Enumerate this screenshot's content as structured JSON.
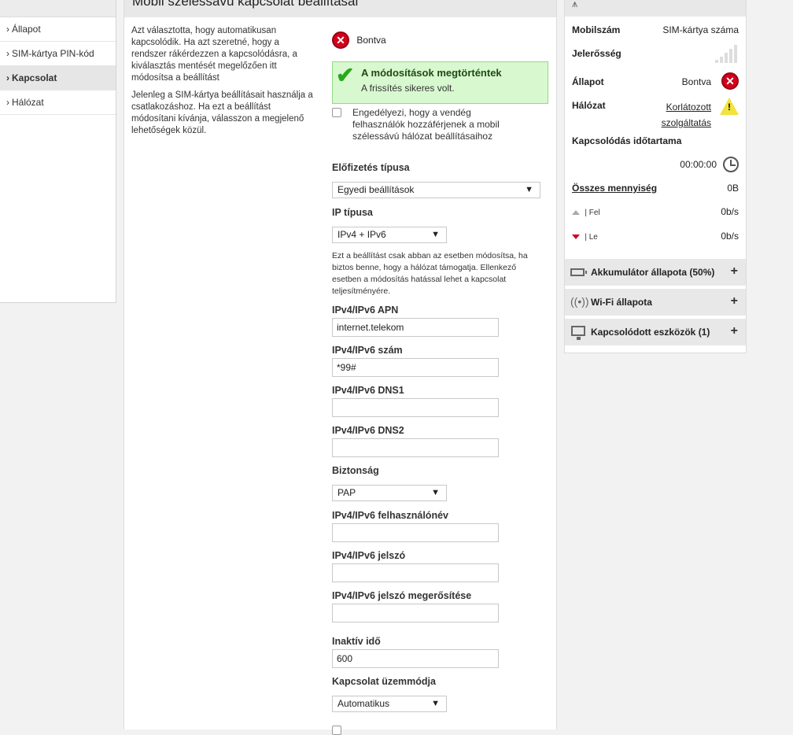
{
  "nav": {
    "items": [
      {
        "label": "Állapot",
        "active": false
      },
      {
        "label": "SIM-kártya PIN-kód",
        "active": false
      },
      {
        "label": "Kapcsolat",
        "active": true
      },
      {
        "label": "Hálózat",
        "active": false
      }
    ]
  },
  "main": {
    "title": "Mobil szélessávú kapcsolat beállításai",
    "description": [
      "Azt választotta, hogy automatikusan kapcsolódik. Ha azt szeretné, hogy a rendszer rákérdezzen a kapcsolódásra, a kiválasztás mentését megelőzően itt módosítsa a beállítást",
      "Jelenleg a SIM-kártya beállításait használja a csatlakozáshoz. Ha ezt a beállítást módosítani kívánja, válasszon a megjelenő lehetőségek közül."
    ],
    "status": "Bontva",
    "success_title": "A módosítások megtörténtek",
    "success_message": "A frissítés sikeres volt.",
    "guest_checkbox_label": "Engedélyezi, hogy a vendég felhasználók hozzáférjenek a mobil szélessávú hálózat beállításaihoz",
    "subscription_type_label": "Előfizetés típusa",
    "subscription_type_value": "Egyedi beállítások",
    "ip_type_label": "IP típusa",
    "ip_type_value": "IPv4 + IPv6",
    "ip_note": "Ezt a beállítást csak abban az esetben módosítsa, ha biztos benne, hogy a hálózat támogatja. Ellenkező esetben a módosítás hatással lehet a kapcsolat teljesítményére.",
    "apn_label": "IPv4/IPv6 APN",
    "apn_value": "internet.telekom",
    "number_label": "IPv4/IPv6 szám",
    "number_value": "*99#",
    "dns1_label": "IPv4/IPv6 DNS1",
    "dns1_value": "",
    "dns2_label": "IPv4/IPv6 DNS2",
    "dns2_value": "",
    "security_label": "Biztonság",
    "security_value": "PAP",
    "username_label": "IPv4/IPv6 felhasználónév",
    "username_value": "",
    "password_label": "IPv4/IPv6 jelszó",
    "password_value": "",
    "password_confirm_label": "IPv4/IPv6 jelszó megerősítése",
    "password_confirm_value": "",
    "idle_label": "Inaktív idő",
    "idle_value": "600",
    "mode_label": "Kapcsolat üzemmódja",
    "mode_value": "Automatikus"
  },
  "right": {
    "mobile_number_label": "Mobilszám",
    "mobile_number_value": "SIM-kártya száma",
    "signal_label": "Jelerősség",
    "state_label": "Állapot",
    "state_value": "Bontva",
    "network_label": "Hálózat",
    "network_value_line1": "Korlátozott",
    "network_value_line2": "szolgáltatás",
    "duration_label": "Kapcsolódás időtartama",
    "duration_value": "00:00:00",
    "total_label": "Összes mennyiség",
    "total_value": "0B",
    "up_label": "| Fel",
    "up_value": "0b/s",
    "down_label": "| Le",
    "down_value": "0b/s",
    "accordions": [
      {
        "title": "Akkumulátor állapota (50%)",
        "icon": "battery-icon"
      },
      {
        "title": "Wi-Fi állapota",
        "icon": "wifi-icon"
      },
      {
        "title": "Kapcsolódott eszközök (1)",
        "icon": "monitor-icon"
      }
    ]
  },
  "colors": {
    "error_red": "#d0021b",
    "success_bg": "#d8f8d0",
    "success_check": "#28a81a",
    "warning_yellow": "#f2e23c"
  }
}
